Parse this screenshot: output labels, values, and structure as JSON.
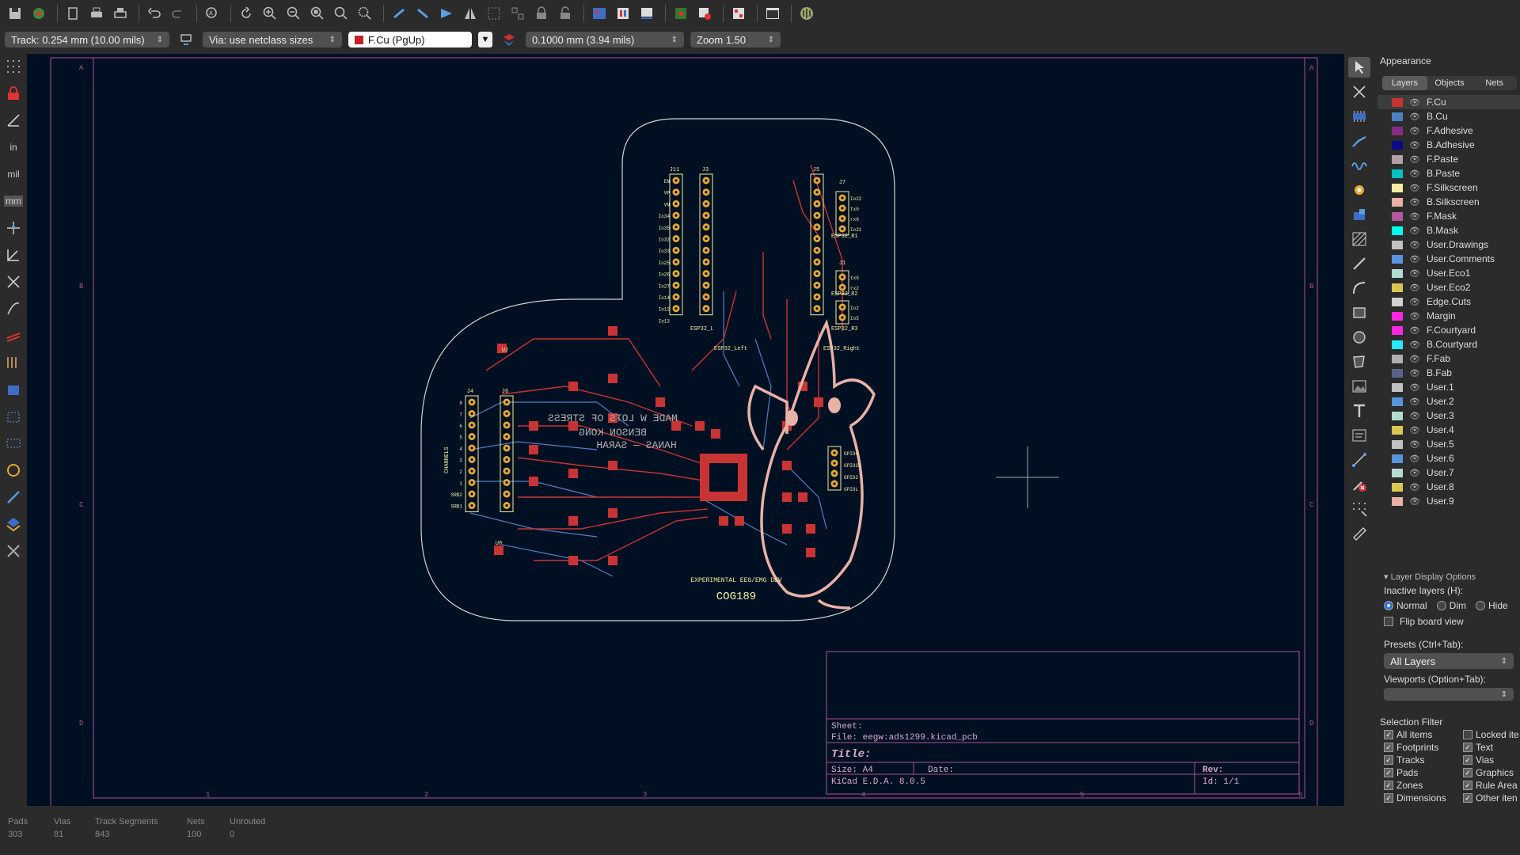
{
  "toolbar": {
    "icons": [
      "save-icon",
      "board-setup-icon",
      "page-settings-icon",
      "print-icon",
      "plot-icon",
      "undo-icon",
      "redo-icon",
      "find-icon",
      "refresh-icon",
      "zoom-in-icon",
      "zoom-out-icon",
      "zoom-fit-icon",
      "zoom-objects-icon",
      "zoom-selection-icon",
      "rotate-ccw-icon",
      "rotate-cw-icon",
      "flip-icon",
      "mirror-icon",
      "group-icon",
      "ungroup-icon",
      "lock-icon",
      "unlock-icon",
      "netlist-icon",
      "footprint-editor-icon",
      "footprint-browser-icon",
      "update-pcb-icon",
      "drc-icon",
      "3d-viewer-icon",
      "scripting-console-icon",
      "plugin-icon"
    ]
  },
  "options": {
    "track": "Track: 0.254 mm (10.00 mils)",
    "via": "Via: use netclass sizes",
    "layer": "F.Cu (PgUp)",
    "layer_color": "#c8202a",
    "grid": "0.1000 mm (3.94 mils)",
    "zoom": "Zoom 1.50"
  },
  "panel": {
    "title": "Appearance",
    "tabs": [
      "Layers",
      "Objects",
      "Nets"
    ],
    "layers": [
      {
        "name": "F.Cu",
        "color": "#c83434"
      },
      {
        "name": "B.Cu",
        "color": "#4d7fc4"
      },
      {
        "name": "F.Adhesive",
        "color": "#842e84"
      },
      {
        "name": "B.Adhesive",
        "color": "#0b0b8a"
      },
      {
        "name": "F.Paste",
        "color": "#b4a0a0"
      },
      {
        "name": "B.Paste",
        "color": "#00c2c2"
      },
      {
        "name": "F.Silkscreen",
        "color": "#f2eda1"
      },
      {
        "name": "B.Silkscreen",
        "color": "#e8b2a7"
      },
      {
        "name": "F.Mask",
        "color": "#b4589f"
      },
      {
        "name": "B.Mask",
        "color": "#02ffee"
      },
      {
        "name": "User.Drawings",
        "color": "#c2c2c2"
      },
      {
        "name": "User.Comments",
        "color": "#5994dc"
      },
      {
        "name": "User.Eco1",
        "color": "#b4dbd2"
      },
      {
        "name": "User.Eco2",
        "color": "#d8c852"
      },
      {
        "name": "Edge.Cuts",
        "color": "#d0d2cd"
      },
      {
        "name": "Margin",
        "color": "#ff26e2"
      },
      {
        "name": "F.Courtyard",
        "color": "#ff26e2"
      },
      {
        "name": "B.Courtyard",
        "color": "#26e9ff"
      },
      {
        "name": "F.Fab",
        "color": "#afafaf"
      },
      {
        "name": "B.Fab",
        "color": "#58658a"
      },
      {
        "name": "User.1",
        "color": "#c2c2c2"
      },
      {
        "name": "User.2",
        "color": "#5994dc"
      },
      {
        "name": "User.3",
        "color": "#b4dbd2"
      },
      {
        "name": "User.4",
        "color": "#d8c852"
      },
      {
        "name": "User.5",
        "color": "#c2c2c2"
      },
      {
        "name": "User.6",
        "color": "#5994dc"
      },
      {
        "name": "User.7",
        "color": "#b4dbd2"
      },
      {
        "name": "User.8",
        "color": "#d8c852"
      },
      {
        "name": "User.9",
        "color": "#e8b2a7"
      }
    ],
    "layer_display_options": "Layer Display Options",
    "inactive_layers": "Inactive layers (H):",
    "inactive_options": [
      "Normal",
      "Dim",
      "Hide"
    ],
    "flip_board": "Flip board view",
    "presets_label": "Presets (Ctrl+Tab):",
    "presets_value": "All Layers",
    "viewports_label": "Viewports (Option+Tab):",
    "selection_filter": "Selection Filter",
    "filters_left": [
      "All items",
      "Footprints",
      "Tracks",
      "Pads",
      "Zones",
      "Dimensions"
    ],
    "filters_right": [
      "Locked ite",
      "Text",
      "Vias",
      "Graphics",
      "Rule Area",
      "Other iten"
    ]
  },
  "canvas": {
    "zone_letters": [
      "A",
      "B",
      "C",
      "D"
    ],
    "zone_numbers": [
      "1",
      "2",
      "3",
      "4",
      "5",
      "6"
    ],
    "title_block": {
      "sheet": "Sheet:",
      "file": "File: eegw:ads1299.kicad_pcb",
      "title": "Title:",
      "size": "Size: A4",
      "date": "Date:",
      "rev": "Rev:",
      "app": "KiCad E.D.A. 8.0.5",
      "id": "Id: 1/1"
    },
    "board_text": {
      "line1": "EXPERIMENTAL EEG/EMG DEV",
      "line2": "COG189",
      "mirror1": "MADE W LOTS OF STRESS",
      "mirror2": "BENSON KONG",
      "mirror3": "HANAS — SARAH",
      "channels": "CHANNELS",
      "j_labels": [
        "J11",
        "J3",
        "J5",
        "J7",
        "J1",
        "J4",
        "J6",
        "U2",
        "U8"
      ],
      "esp_left": "ESP32_L",
      "esp_left2": "ESP32_Left",
      "esp_right": "ESP32_Right",
      "esp_r1": "ESP32_R1",
      "esp_r2": "ESP32_R2",
      "esp_r3": "ESP32_R3",
      "gpio": [
        "GPIO4",
        "GPIO33",
        "GPIO2",
        "GPIOL"
      ],
      "io_left": [
        "EN",
        "VP",
        "VN",
        "Io34",
        "Io35",
        "Io32",
        "Io33",
        "Io25",
        "Io26",
        "Io27",
        "Io14",
        "Io12",
        "Io13"
      ],
      "io_right_top": [
        "Io22",
        "tx0",
        "rx0",
        "Io21"
      ],
      "io_right_mid": [
        "tx0",
        "rx2"
      ],
      "io_right_bot": [
        "Io2",
        "Io5"
      ],
      "ch_pins": [
        "8",
        "7",
        "6",
        "5",
        "4",
        "3",
        "2",
        "1",
        "SRB2",
        "SRB1"
      ]
    }
  },
  "status": {
    "columns": [
      "Pads",
      "Vias",
      "Track Segments",
      "Nets",
      "Unrouted"
    ],
    "values": [
      "303",
      "81",
      "843",
      "100",
      "0"
    ]
  }
}
